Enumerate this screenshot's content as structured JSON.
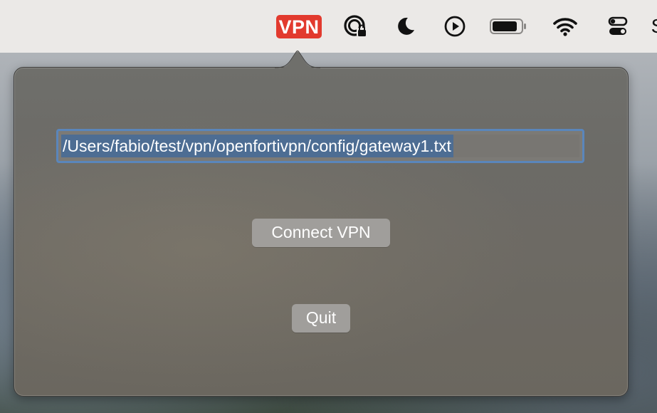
{
  "menubar": {
    "vpn_label": "VPN",
    "icons": [
      "vpn-status-icon",
      "screen-time-lock-icon",
      "do-not-disturb-moon-icon",
      "now-playing-icon",
      "battery-icon",
      "wifi-icon",
      "control-center-icon"
    ],
    "cut_text": "S"
  },
  "popover": {
    "config_path": "/Users/fabio/test/vpn/openfortivpn/config/gateway1.txt",
    "connect_label": "Connect VPN",
    "quit_label": "Quit"
  },
  "colors": {
    "vpn_badge": "#e23a2e",
    "focus_ring": "#5a86bb",
    "selection": "#4d6d93",
    "button": "#a09e9b"
  }
}
